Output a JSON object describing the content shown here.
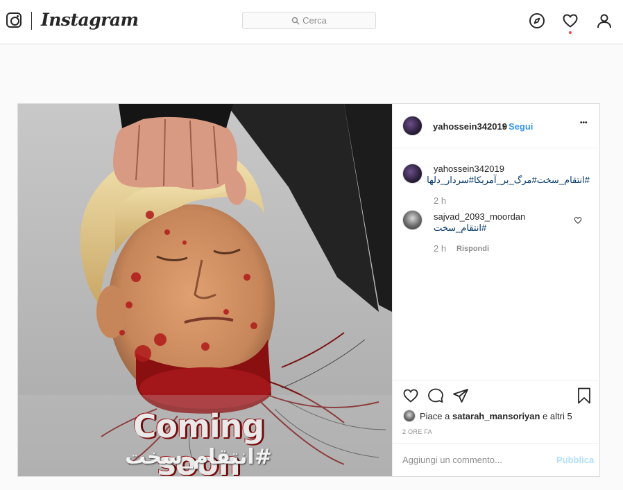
{
  "topbar": {
    "wordmark": "Instagram",
    "search_placeholder": "Cerca",
    "icons": [
      "instagram-glyph",
      "compass-icon",
      "heart-icon",
      "profile-icon"
    ]
  },
  "post": {
    "author": "yahossein342019",
    "separator": "•",
    "follow_label": "Segui",
    "more_label": "•••",
    "image_text": {
      "headline": "Coming soon",
      "hashtag": "#انتقام_سخت"
    },
    "caption": {
      "username": "yahossein342019",
      "text": "#انتقام_سخت#مرگ_بر_آمریکا#سردار_دلها",
      "time": "2 h"
    },
    "comments": [
      {
        "username": "sajvad_2093_moordan",
        "text": "#انتقام_سخت",
        "time": "2 h",
        "reply_label": "Rispondi"
      }
    ],
    "likes_prefix": "Piace a",
    "likes_user": "satarah_mansoriyan",
    "likes_suffix": "e altri 5",
    "timestamp": "2 ORE FA",
    "add_comment_placeholder": "Aggiungi un commento...",
    "publish_label": "Pubblica"
  },
  "colors": {
    "link_blue": "#3897f0",
    "hashtag_blue": "#00376b",
    "muted": "#8e8e8e",
    "notification_red": "#ed4956"
  }
}
